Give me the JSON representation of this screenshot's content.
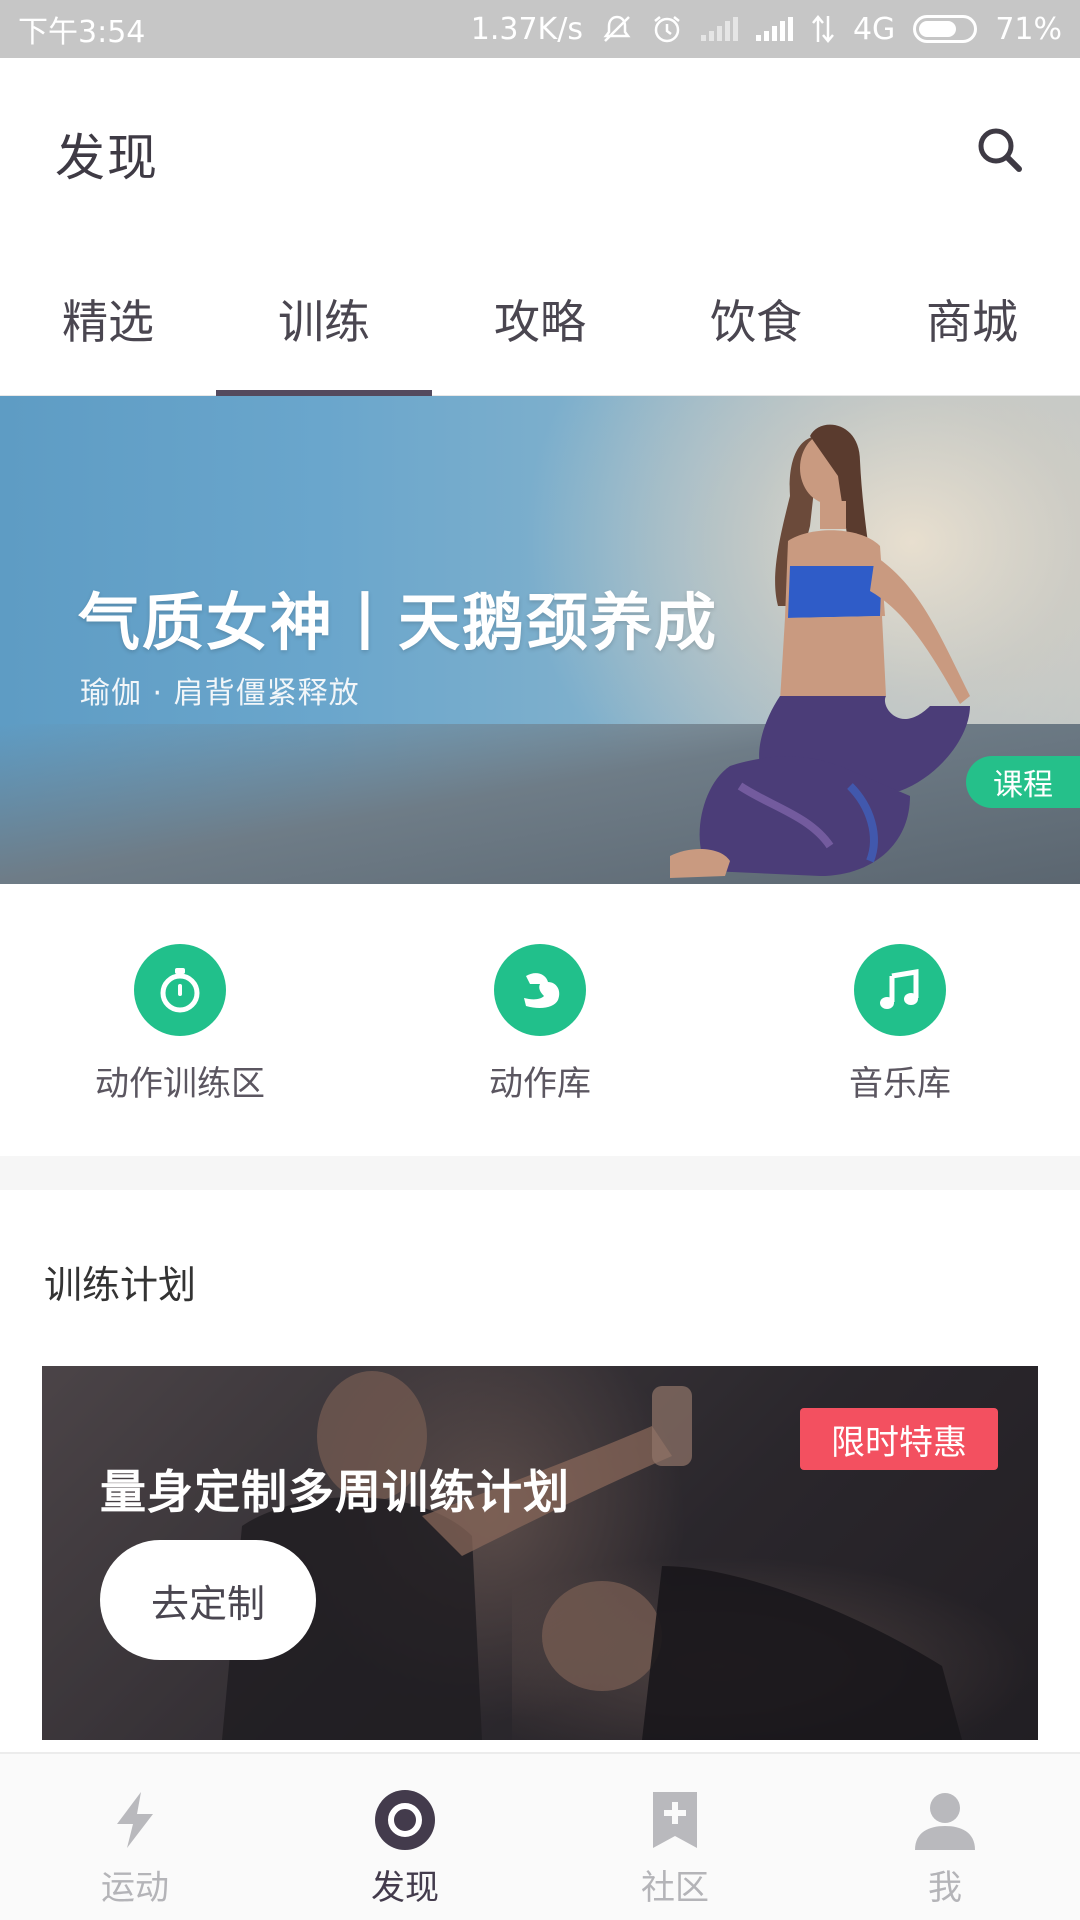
{
  "status_bar": {
    "time": "下午3:54",
    "net_speed": "1.37K/s",
    "network": "4G",
    "battery": "71%",
    "battery_level": 0.71
  },
  "header": {
    "title": "发现",
    "search_icon": "search-icon"
  },
  "tabs": [
    {
      "label": "精选",
      "active": false
    },
    {
      "label": "训练",
      "active": true
    },
    {
      "label": "攻略",
      "active": false
    },
    {
      "label": "饮食",
      "active": false
    },
    {
      "label": "商城",
      "active": false
    }
  ],
  "banner": {
    "title": "气质女神丨天鹅颈养成",
    "subtitle": "瑜伽 · 肩背僵紧释放",
    "badge": "课程"
  },
  "quick_entries": [
    {
      "label": "动作训练区",
      "icon": "stopwatch-icon"
    },
    {
      "label": "动作库",
      "icon": "muscle-arm-icon"
    },
    {
      "label": "音乐库",
      "icon": "music-note-icon"
    }
  ],
  "training_plan": {
    "section_title": "训练计划",
    "card_title": "量身定制多周训练计划",
    "button": "去定制",
    "badge": "限时特惠"
  },
  "bottom_nav": [
    {
      "label": "运动",
      "icon": "lightning-icon",
      "active": false
    },
    {
      "label": "发现",
      "icon": "discover-ring-icon",
      "active": true
    },
    {
      "label": "社区",
      "icon": "bookmark-plus-icon",
      "active": false
    },
    {
      "label": "我",
      "icon": "user-icon",
      "active": false
    }
  ],
  "colors": {
    "accent_green": "#21c08b",
    "active_tab": "#544a5e",
    "promo_red": "#f35060"
  }
}
